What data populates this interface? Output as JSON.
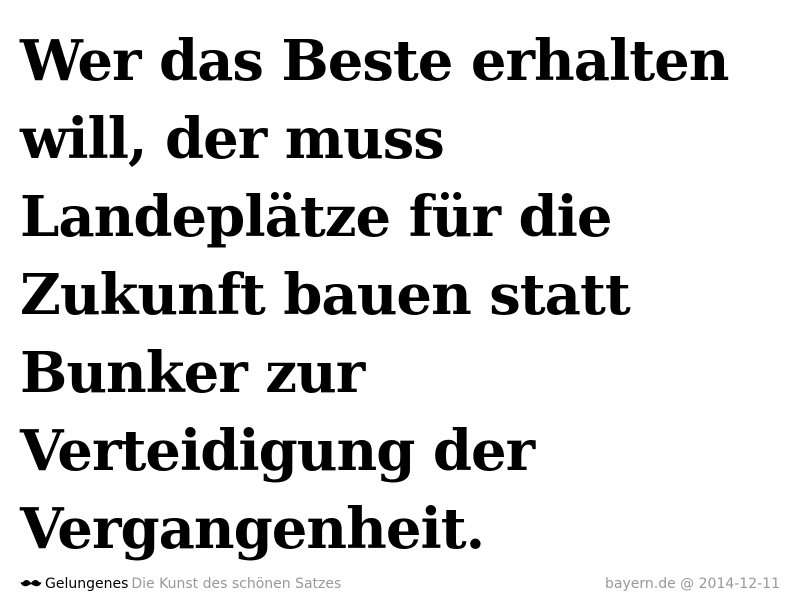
{
  "quote": {
    "lines": [
      "Wer das Beste erhalten",
      "will, der muss",
      "Landeplätze für die",
      "Zukunft bauen statt",
      "Bunker zur",
      "Verteidigung der",
      "Vergangenheit."
    ]
  },
  "footer": {
    "icon": "mustache-icon",
    "site_name": "Gelungenes",
    "tagline": "Die Kunst des schönen Satzes",
    "source": "bayern.de @ 2014-12-11"
  },
  "colors": {
    "text": "#000000",
    "muted": "#999999",
    "background": "#ffffff"
  }
}
